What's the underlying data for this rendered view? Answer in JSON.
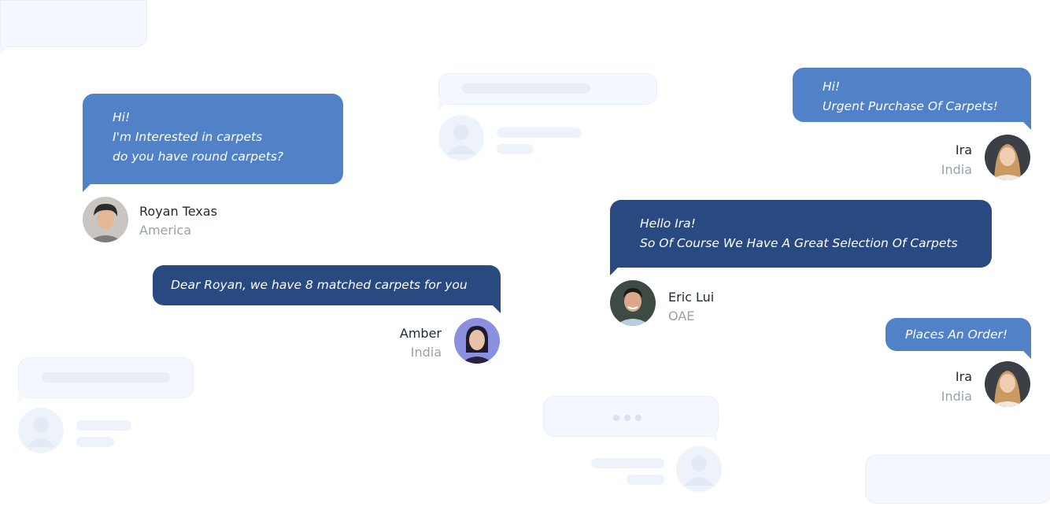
{
  "colors": {
    "bubble_light": "#5181c6",
    "bubble_dark": "#284a80",
    "ghost": "#f4f7fd",
    "name": "#222a36",
    "location": "#9aa1ab"
  },
  "conversations": [
    {
      "id": "royan",
      "lines": [
        "Hi!",
        "I'm Interested in carpets",
        "do you have round carpets?"
      ],
      "user": {
        "name": "Royan Texas",
        "location": "America",
        "avatar": "person-avatar"
      }
    },
    {
      "id": "amber",
      "lines": [
        "Dear Royan, we have 8 matched carpets for you"
      ],
      "user": {
        "name": "Amber",
        "location": "India",
        "avatar": "person-avatar"
      }
    },
    {
      "id": "ira1",
      "lines": [
        "Hi!",
        "Urgent Purchase Of Carpets!"
      ],
      "user": {
        "name": "Ira",
        "location": "India",
        "avatar": "person-avatar"
      }
    },
    {
      "id": "eric",
      "lines": [
        "Hello Ira!",
        "So Of Course We Have A Great Selection Of Carpets"
      ],
      "user": {
        "name": "Eric Lui",
        "location": "OAE",
        "avatar": "person-avatar"
      }
    },
    {
      "id": "ira2",
      "lines": [
        "Places An Order!"
      ],
      "user": {
        "name": "Ira",
        "location": "India",
        "avatar": "person-avatar"
      }
    }
  ],
  "placeholders": {
    "typing_indicator": "typing-dots-icon",
    "ghost_avatar": "user-silhouette-icon"
  }
}
